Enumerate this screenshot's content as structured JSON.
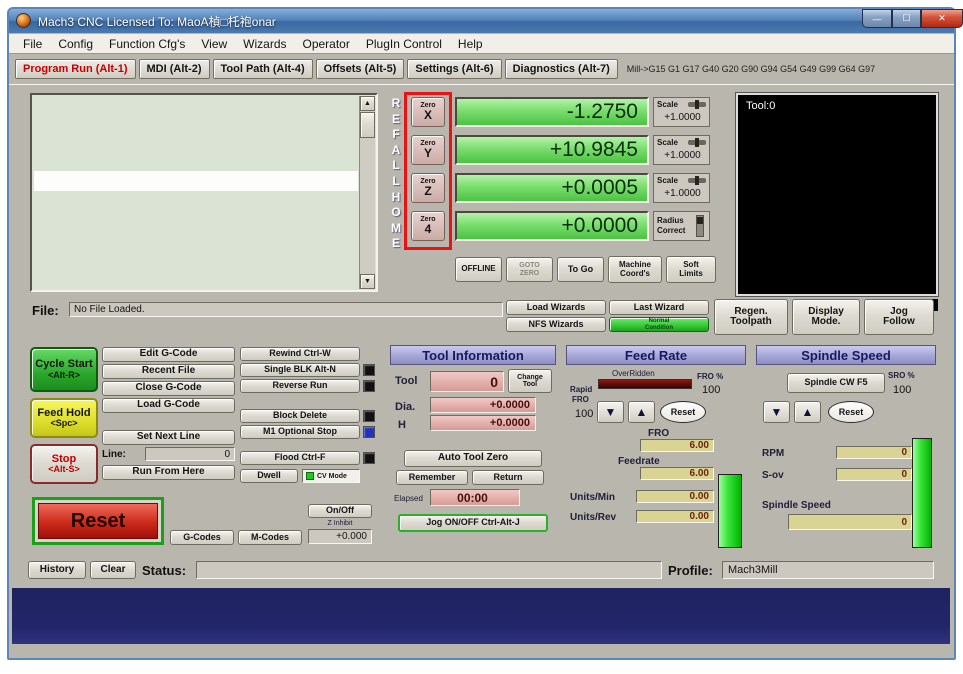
{
  "window": {
    "title": "Mach3 CNC Licensed To: MaoA楨□杔袍onar"
  },
  "icons": {
    "minimize": "—",
    "maximize": "☐",
    "close": "✕",
    "arrow_up": "▲",
    "arrow_down": "▼"
  },
  "menu": {
    "items": [
      "File",
      "Config",
      "Function Cfg's",
      "View",
      "Wizards",
      "Operator",
      "PlugIn Control",
      "Help"
    ]
  },
  "tabs": {
    "items": [
      "Program Run (Alt-1)",
      "MDI (Alt-2)",
      "Tool Path (Alt-4)",
      "Offsets (Alt-5)",
      "Settings (Alt-6)",
      "Diagnostics (Alt-7)"
    ],
    "active": "Program Run (Alt-1)",
    "modal_string": "Mill->G15 G1 G17 G40 G20 G90 G94 G54 G49 G99 G64 G97"
  },
  "dro": {
    "ref_letters": [
      "R",
      "E",
      "F",
      "A",
      "L",
      "L",
      "H",
      "O",
      "M",
      "E"
    ],
    "axes": [
      {
        "zero": "Zero",
        "axis": "X",
        "value": "-1.2750",
        "scale_label": "Scale",
        "scale_value": "+1.0000"
      },
      {
        "zero": "Zero",
        "axis": "Y",
        "value": "+10.9845",
        "scale_label": "Scale",
        "scale_value": "+1.0000"
      },
      {
        "zero": "Zero",
        "axis": "Z",
        "value": "+0.0005",
        "scale_label": "Scale",
        "scale_value": "+1.0000"
      },
      {
        "zero": "Zero",
        "axis": "4",
        "value": "+0.0000",
        "radius_line1": "Radius",
        "radius_line2": "Correct"
      }
    ],
    "offline": "OFFLINE",
    "goto_zero_line1": "GOTO",
    "goto_zero_line2": "ZERO",
    "to_go": "To Go",
    "machine_coords_line1": "Machine",
    "machine_coords_line2": "Coord's",
    "soft_limits_line1": "Soft",
    "soft_limits_line2": "Limits"
  },
  "toolpath": {
    "tool_label": "Tool:0"
  },
  "file_bar": {
    "label": "File:",
    "value": "No File Loaded.",
    "load_wizards": "Load Wizards",
    "last_wizard": "Last Wizard",
    "nfs_wizards": "NFS Wizards",
    "condition_line1": "Normal",
    "condition_line2": "Condition",
    "regen_line1": "Regen.",
    "regen_line2": "Toolpath",
    "display_line1": "Display",
    "display_line2": "Mode.",
    "jog_line1": "Jog",
    "jog_line2": "Follow"
  },
  "control": {
    "cycle_start_line1": "Cycle Start",
    "cycle_start_line2": "<Alt-R>",
    "feed_hold_line1": "Feed Hold",
    "feed_hold_line2": "<Spc>",
    "stop_line1": "Stop",
    "stop_line2": "<Alt-S>",
    "edit_gcode": "Edit G-Code",
    "recent_file": "Recent File",
    "close_gcode": "Close G-Code",
    "load_gcode": "Load G-Code",
    "set_next_line": "Set Next Line",
    "line_label": "Line:",
    "line_value": "0",
    "run_from_here": "Run From Here",
    "rewind": "Rewind Ctrl-W",
    "single_blk": "Single BLK Alt-N",
    "reverse_run": "Reverse Run",
    "block_delete": "Block Delete",
    "m1_optional_stop": "M1 Optional Stop",
    "flood": "Flood Ctrl-F",
    "dwell": "Dwell",
    "cv_mode": "CV Mode",
    "reset": "Reset",
    "gcodes": "G-Codes",
    "mcodes": "M-Codes",
    "on_off": "On/Off",
    "z_inhibit_label": "Z Inhibit",
    "z_inhibit_value": "+0.000"
  },
  "tool_info": {
    "header": "Tool Information",
    "tool_label": "Tool",
    "tool_value": "0",
    "change_label": "Change",
    "tool_small_label": "Tool",
    "dia_label": "Dia.",
    "dia_value": "+0.0000",
    "h_label": "H",
    "h_value": "+0.0000",
    "auto_tool_zero": "Auto Tool Zero",
    "remember": "Remember",
    "return": "Return",
    "elapsed_label": "Elapsed",
    "elapsed_value": "00:00",
    "jog_on_off": "Jog ON/OFF Ctrl-Alt-J"
  },
  "feed_rate": {
    "header": "Feed Rate",
    "overridden_label": "OverRidden",
    "fro_pct_label": "FRO %",
    "fro_pct_value": "100",
    "rapid_label": "Rapid",
    "fro_small_label": "FRO",
    "rapid_value": "100",
    "reset": "Reset",
    "fro_label": "FRO",
    "fro_value": "6.00",
    "feedrate_label": "Feedrate",
    "feedrate_value": "6.00",
    "units_min_label": "Units/Min",
    "units_min_value": "0.00",
    "units_rev_label": "Units/Rev",
    "units_rev_value": "0.00"
  },
  "spindle": {
    "header": "Spindle Speed",
    "cw_button": "Spindle CW F5",
    "sro_label": "SRO %",
    "sro_value": "100",
    "reset": "Reset",
    "rpm_label": "RPM",
    "rpm_value": "0",
    "sov_label": "S-ov",
    "sov_value": "0",
    "speed_label": "Spindle Speed",
    "speed_value": "0"
  },
  "status_bar": {
    "history": "History",
    "clear": "Clear",
    "status_label": "Status:",
    "status_value": "",
    "profile_label": "Profile:",
    "profile_value": "Mach3Mill"
  },
  "colors": {
    "dro_green": "#7ade6e",
    "display_pink": "#e0a8a2",
    "display_yellow": "#d9d494",
    "header_blue": "#a3a3d4",
    "annotation_red": "#e81414",
    "bar_green": "#3ce43c",
    "reset_red": "#c42020"
  }
}
